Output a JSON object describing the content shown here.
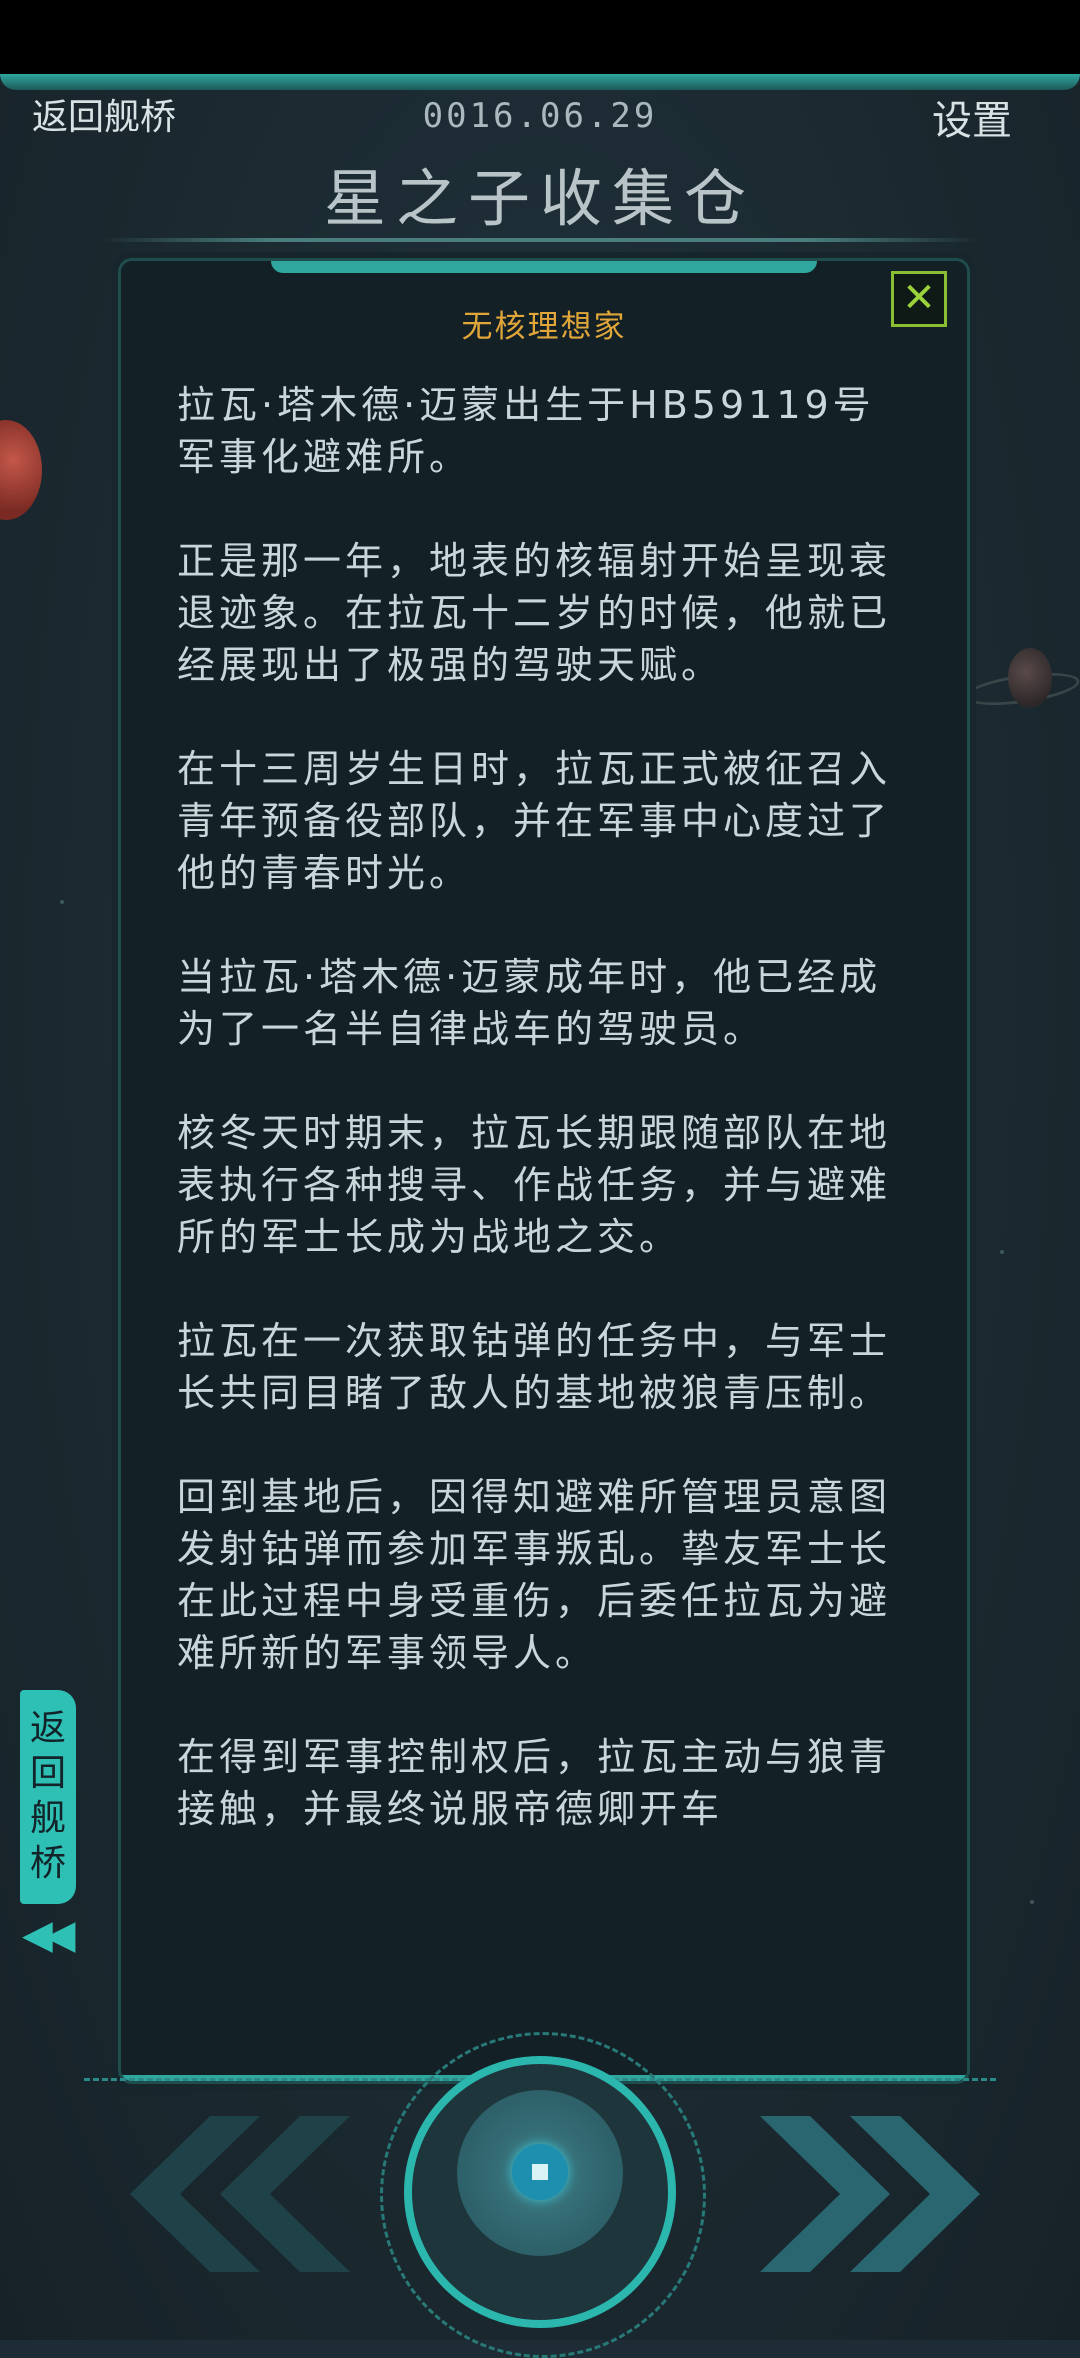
{
  "header": {
    "back_label": "返回舰桥",
    "date": "0016.06.29",
    "settings_label": "设置",
    "title": "星之子收集仓"
  },
  "panel": {
    "heading": "无核理想家",
    "close_icon": "close-icon",
    "paragraphs": [
      "拉瓦·塔木德·迈蒙出生于HB59119号军事化避难所。",
      "正是那一年，地表的核辐射开始呈现衰退迹象。在拉瓦十二岁的时候，他就已经展现出了极强的驾驶天赋。",
      "在十三周岁生日时，拉瓦正式被征召入青年预备役部队，并在军事中心度过了他的青春时光。",
      "当拉瓦·塔木德·迈蒙成年时，他已经成为了一名半自律战车的驾驶员。",
      "核冬天时期末，拉瓦长期跟随部队在地表执行各种搜寻、作战任务，并与避难所的军士长成为战地之交。",
      "拉瓦在一次获取钴弹的任务中，与军士长共同目睹了敌人的基地被狼青压制。",
      "回到基地后，因得知避难所管理员意图发射钴弹而参加军事叛乱。挚友军士长在此过程中身受重伤，后委任拉瓦为避难所新的军事领导人。",
      "在得到军事控制权后，拉瓦主动与狼青接触，并最终说服帝德卿开车"
    ]
  },
  "side_tab": {
    "label": "返回舰桥",
    "arrow_icon": "double-chevron-left-icon"
  },
  "nav": {
    "prev_icon": "double-chevron-left-icon",
    "next_icon": "double-chevron-right-icon",
    "hub_icon": "center-hub-button-icon"
  },
  "colors": {
    "accent": "#2fc0b5",
    "heading": "#e0a63a",
    "close": "#9bd33a",
    "background": "#1e2d35"
  }
}
